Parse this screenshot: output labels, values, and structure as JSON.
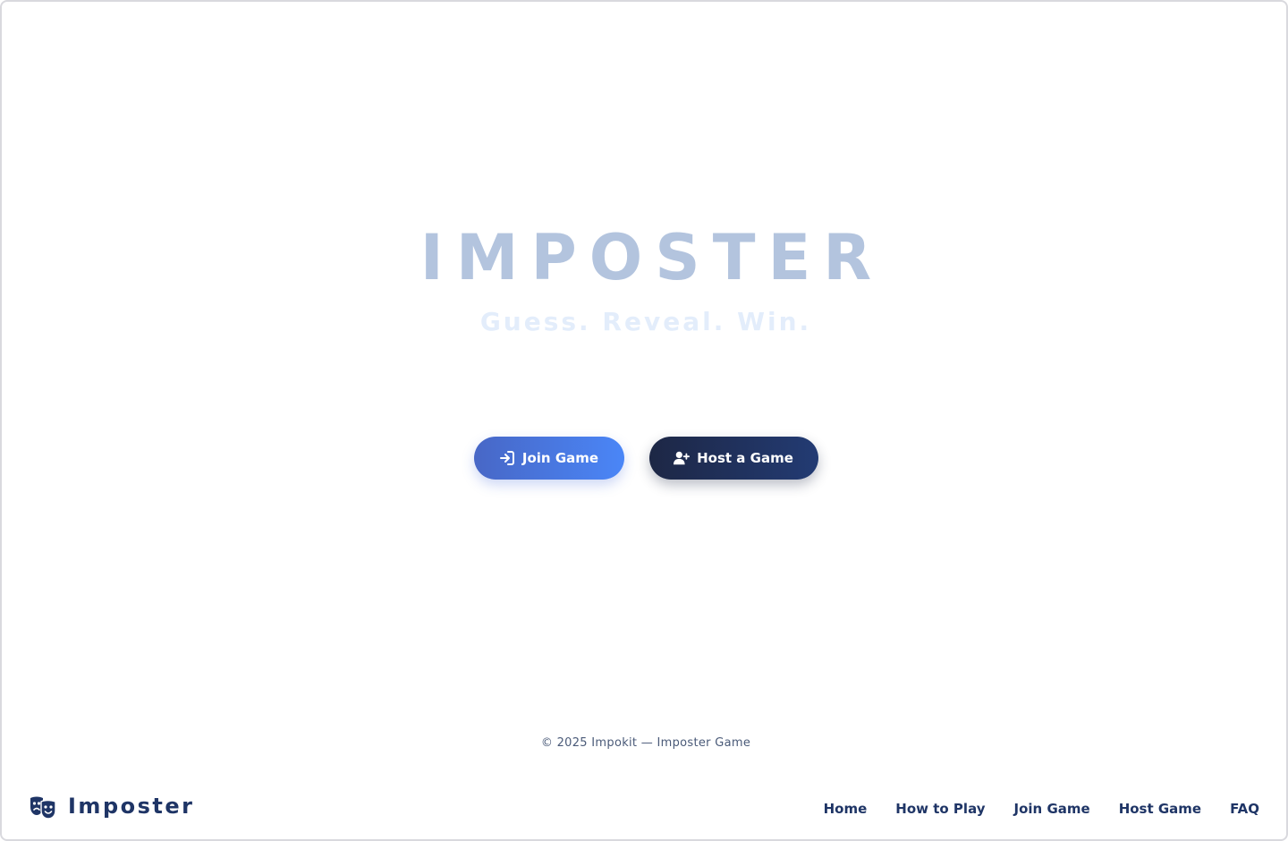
{
  "hero": {
    "title": "IMPOSTER",
    "subtitle": "Guess. Reveal. Win."
  },
  "actions": {
    "join_label": "Join Game",
    "join_icon": "sign-in-icon",
    "host_label": "Host a Game",
    "host_icon": "user-plus-icon"
  },
  "footer": {
    "copyright": "© 2025  Impokit — Imposter Game",
    "brand_name": "Imposter",
    "brand_icon": "theater-masks-icon",
    "nav": [
      {
        "label": "Home"
      },
      {
        "label": "How to Play"
      },
      {
        "label": "Join Game"
      },
      {
        "label": "Host Game"
      },
      {
        "label": "FAQ"
      }
    ]
  },
  "colors": {
    "title": "#b3c4de",
    "subtitle": "#e3edfb",
    "join_gradient_start": "#4867c6",
    "join_gradient_end": "#4a86f7",
    "host_gradient_start": "#1d2745",
    "host_gradient_end": "#233b73",
    "brand": "#1f3566"
  }
}
